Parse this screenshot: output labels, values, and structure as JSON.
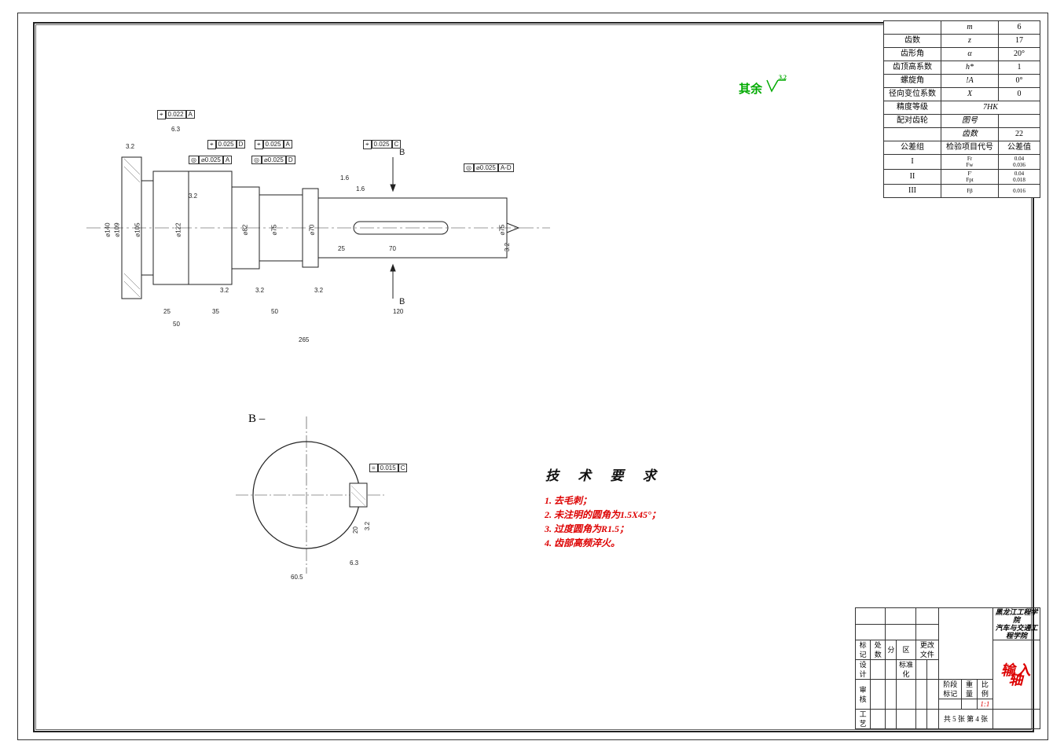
{
  "surface_note": "其余",
  "surface_sym": "3.2",
  "gear_params": {
    "rows": [
      {
        "label": "",
        "sym": "m",
        "val": "6"
      },
      {
        "label": "齿数",
        "sym": "z",
        "val": "17"
      },
      {
        "label": "齿形角",
        "sym": "α",
        "val": "20°"
      },
      {
        "label": "齿顶高系数",
        "sym": "h*",
        "val": "1"
      },
      {
        "label": "螺旋角",
        "sym": "!A",
        "val": "0°"
      },
      {
        "label": "径向变位系数",
        "sym": "X",
        "val": "0"
      },
      {
        "label": "精度等级",
        "sym": "7HK",
        "val": ""
      },
      {
        "label": "配对齿轮",
        "sym": "图号",
        "val": ""
      },
      {
        "label": "",
        "sym": "齿数",
        "val": "22"
      }
    ],
    "tol_header": {
      "a": "公差组",
      "b": "检验项目代号",
      "c": "公差值"
    },
    "tol_rows": [
      {
        "a": "I",
        "b": "Fr\nFw",
        "c": "0.04\n0.036"
      },
      {
        "a": "II",
        "b": "F'\nFpt",
        "c": "0.04\n0.018"
      },
      {
        "a": "III",
        "b": "Fβ",
        "c": "0.016"
      }
    ]
  },
  "main_view": {
    "overall_length": "265",
    "segments": [
      "25",
      "50",
      "35",
      "50",
      "120"
    ],
    "keyway": {
      "len": "70",
      "offset": "25"
    },
    "diameters": [
      "⌀140",
      "⌀109",
      "⌀105",
      "⌀122",
      "⌀82",
      "⌀75",
      "⌀70",
      "⌀75"
    ],
    "surface_marks": [
      "6.3",
      "3.2",
      "3.2",
      "3.2",
      "3.2",
      "3.2",
      "1.6",
      "1.6",
      "3.2"
    ],
    "fcf": [
      {
        "sym": "⌖",
        "tol": "0.022",
        "datum": "A"
      },
      {
        "sym": "⌖",
        "tol": "0.025",
        "datum": "D"
      },
      {
        "sym": "⌖",
        "tol": "0.025",
        "datum": "A"
      },
      {
        "sym": "⌖",
        "tol": "0.025",
        "datum": "C"
      },
      {
        "sym": "◎",
        "tol": "⌀0.025",
        "datum": "A"
      },
      {
        "sym": "◎",
        "tol": "⌀0.025",
        "datum": "D"
      },
      {
        "sym": "◎",
        "tol": "⌀0.025",
        "datum": "A-D"
      }
    ],
    "section_mark": "B",
    "chamfer": "1.6"
  },
  "section_view": {
    "label": "B  –",
    "key_w": "20",
    "key_surf": "3.2",
    "dia_surf": "6.3",
    "fcf": {
      "sym": "=",
      "tol": "0.015",
      "datum": "C"
    },
    "key_dim": "60.5"
  },
  "notes": {
    "title": "技 术 要 求",
    "items": [
      "1. 去毛刺；",
      "2. 未注明的圆角为1.5X45°；",
      "3. 过度圆角为R1.5；",
      "4. 齿部高频淬火。"
    ]
  },
  "title_block": {
    "institution": "黑龙江工程学院\n汽车与交通工程学院",
    "part_name": "输入轴",
    "rows": {
      "标记": "标记",
      "处数": "处数",
      "分": "分",
      "区": "区",
      "更改文件": "更改文件",
      "设计": "设计",
      "标准化": "标准化",
      "阶段标记": "阶段标记",
      "重量": "重量",
      "比例": "比例",
      "scale": "1:1",
      "审核": "审核",
      "工艺": "工艺",
      "sheets": "共 5 张  第 4 张"
    }
  }
}
